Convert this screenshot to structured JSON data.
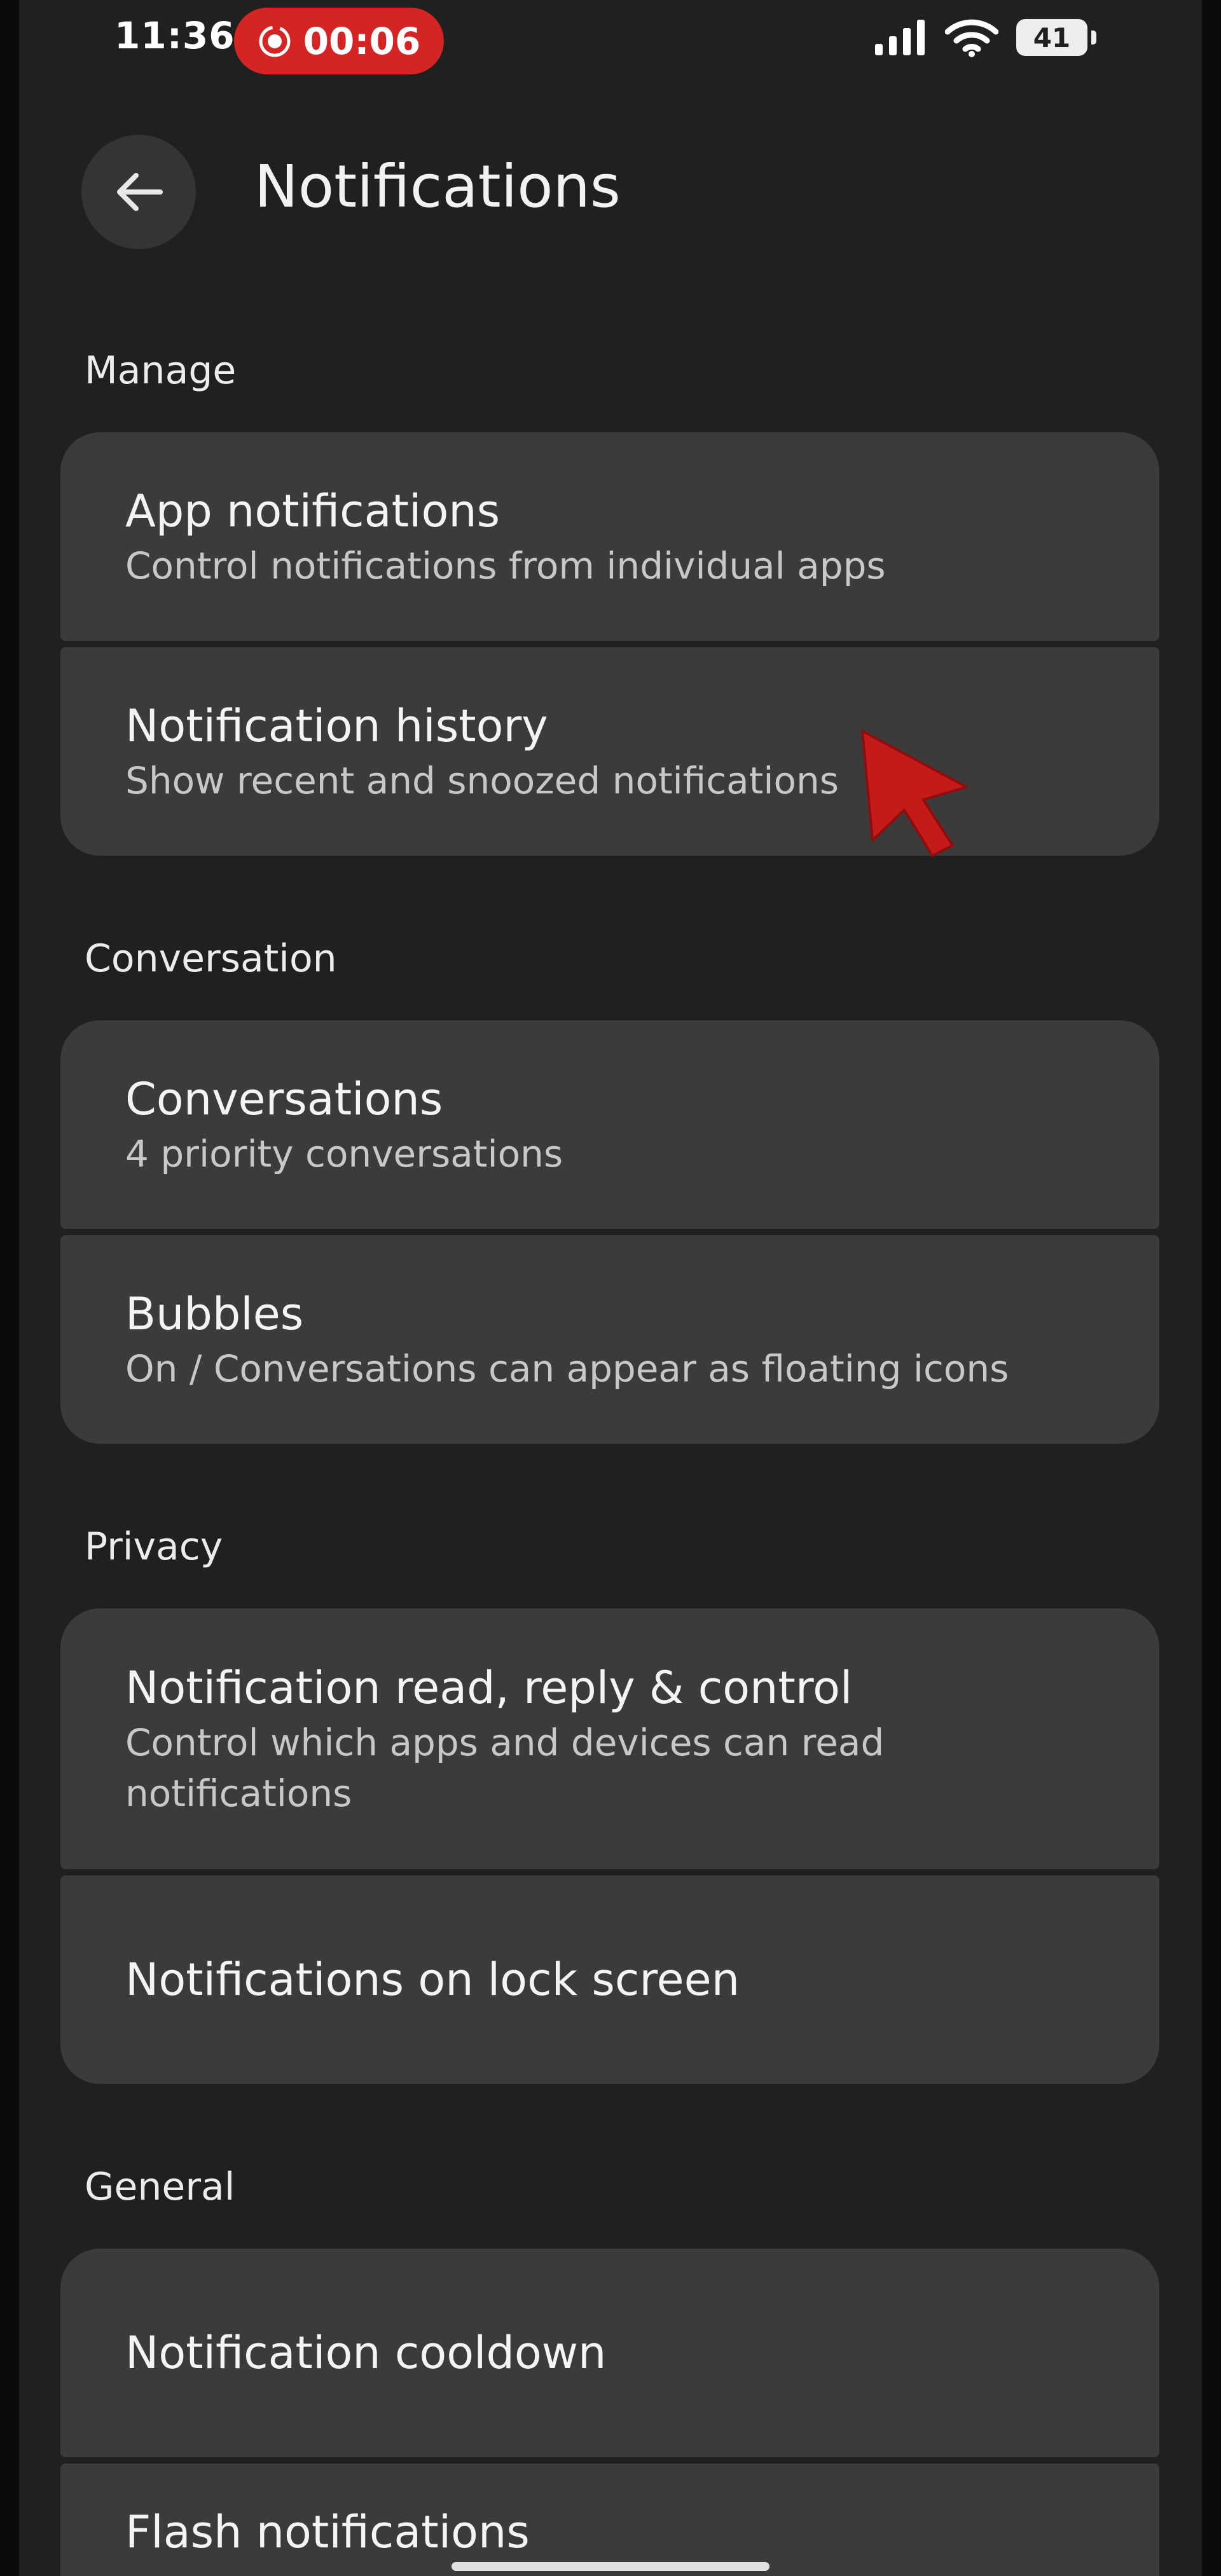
{
  "status_bar": {
    "time": "11:36",
    "recording_time": "00:06",
    "battery": "41",
    "icons": [
      "signal-icon",
      "wifi-icon",
      "battery-icon"
    ]
  },
  "header": {
    "title": "Notifications",
    "back_icon": "arrow-left-icon"
  },
  "sections": {
    "manage": "Manage",
    "conversation": "Conversation",
    "privacy": "Privacy",
    "general": "General"
  },
  "items": {
    "app_notifications": {
      "title": "App notifications",
      "subtitle": "Control notifications from individual apps"
    },
    "notification_history": {
      "title": "Notification history",
      "subtitle": "Show recent and snoozed notifications"
    },
    "conversations": {
      "title": "Conversations",
      "subtitle": "4 priority conversations"
    },
    "bubbles": {
      "title": "Bubbles",
      "subtitle": "On / Conversations can appear as floating icons"
    },
    "read_reply_control": {
      "title": "Notification read, reply & control",
      "subtitle": "Control which apps and devices can read notifications"
    },
    "lock_screen": {
      "title": "Notifications on lock screen"
    },
    "cooldown": {
      "title": "Notification cooldown"
    },
    "flash": {
      "title": "Flash notifications"
    }
  },
  "colors": {
    "background": "#202020",
    "card": "#3b3b3b",
    "recording": "#d42424",
    "cursor": "#c41a1a"
  }
}
